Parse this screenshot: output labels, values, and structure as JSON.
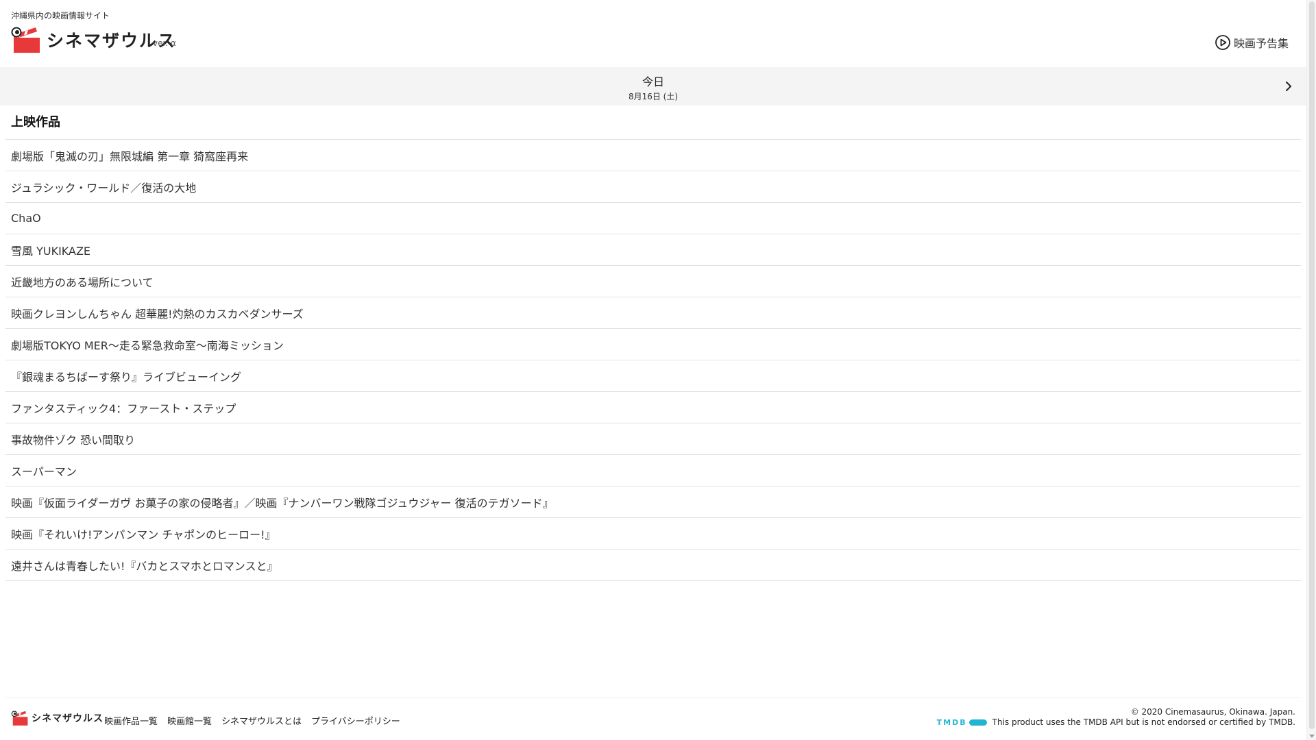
{
  "header": {
    "tagline": "沖縄県内の映画情報サイト",
    "site_name": "シネマザウルス",
    "version": "ver. α",
    "trailer_label": "映画予告集"
  },
  "datebar": {
    "main": "今日",
    "sub": "8月16日 (土)"
  },
  "section": {
    "title": "上映作品"
  },
  "movies": [
    "劇場版「鬼滅の刃」無限城編 第一章 猗窩座再来",
    "ジュラシック・ワールド／復活の大地",
    "ChaO",
    "雪風 YUKIKAZE",
    "近畿地方のある場所について",
    "映画クレヨンしんちゃん 超華麗!灼熱のカスカベダンサーズ",
    "劇場版TOKYO MER～走る緊急救命室～南海ミッション",
    "『銀魂まるちばーす祭り』ライブビューイング",
    "ファンタスティック4：ファースト・ステップ",
    "事故物件ゾク 恐い間取り",
    "スーパーマン",
    "映画『仮面ライダーガヴ お菓子の家の侵略者』／映画『ナンバーワン戦隊ゴジュウジャー 復活のテガソード』",
    "映画『それいけ!アンパンマン チャポンのヒーロー!』",
    "遠井さんは青春したい!『バカとスマホとロマンスと』"
  ],
  "footer": {
    "site_name": "シネマザウルス",
    "links": [
      "映画作品一覧",
      "映画館一覧",
      "シネマザウルスとは",
      "プライバシーポリシー"
    ],
    "copyright": "© 2020 Cinemasaurus, Okinawa. Japan.",
    "tmdb_logo": "TMDB",
    "tmdb_note": "This product uses the TMDB API but is not endorsed or certified by TMDB."
  },
  "colors": {
    "brand_red": "#e8393a",
    "tmdb_blue": "#26b7cf"
  }
}
